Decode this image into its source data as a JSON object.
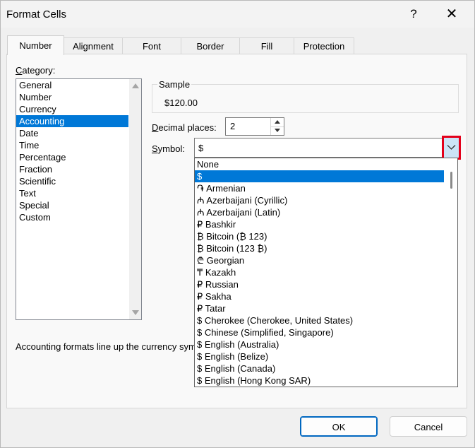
{
  "window": {
    "title": "Format Cells",
    "help_glyph": "?",
    "close_glyph": "✕"
  },
  "tabs": [
    "Number",
    "Alignment",
    "Font",
    "Border",
    "Fill",
    "Protection"
  ],
  "active_tab": "Number",
  "category": {
    "label_prefix": "C",
    "label_rest": "ategory:",
    "items": [
      "General",
      "Number",
      "Currency",
      "Accounting",
      "Date",
      "Time",
      "Percentage",
      "Fraction",
      "Scientific",
      "Text",
      "Special",
      "Custom"
    ],
    "selected": "Accounting"
  },
  "sample": {
    "label": "Sample",
    "value": "$120.00"
  },
  "decimal_places": {
    "label_prefix": "D",
    "label_rest": "ecimal places:",
    "value": "2"
  },
  "symbol": {
    "label_prefix": "S",
    "label_rest": "ymbol:",
    "value": "$",
    "options": [
      "None",
      "$",
      "֏ Armenian",
      "₼ Azerbaijani (Cyrillic)",
      "₼ Azerbaijani (Latin)",
      "₽ Bashkir",
      "₿ Bitcoin (₿ 123)",
      "₿ Bitcoin (123 ₿)",
      "₾ Georgian",
      "₸ Kazakh",
      "₽ Russian",
      "₽ Sakha",
      "₽ Tatar",
      "$ Cherokee (Cherokee, United States)",
      "$ Chinese (Simplified, Singapore)",
      "$ English (Australia)",
      "$ English (Belize)",
      "$ English (Canada)",
      "$ English (Hong Kong SAR)"
    ],
    "selected_index": 1,
    "highlight_color": "#e3001b"
  },
  "description": "Accounting formats line up the currency symbols and decimal points in a column.",
  "buttons": {
    "ok": "OK",
    "cancel": "Cancel"
  },
  "accent_color": "#0078d7"
}
